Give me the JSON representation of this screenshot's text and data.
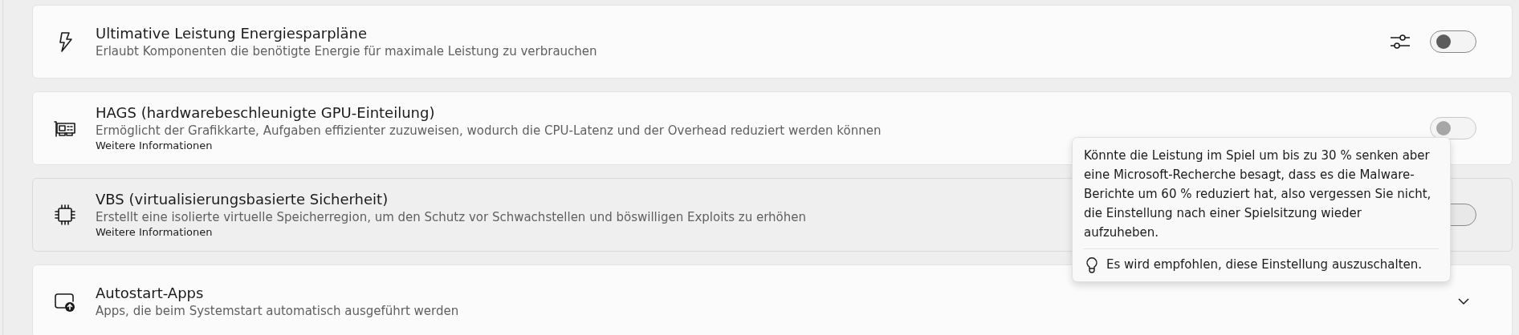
{
  "settings": [
    {
      "title": "Ultimative Leistung Energiesparpläne",
      "description": "Erlaubt Komponenten die benötigte Energie für maximale Leistung zu verbrauchen",
      "kind": "toggle",
      "on": false,
      "disabled": false,
      "hovered": false,
      "has_options": true
    },
    {
      "title": "HAGS (hardwarebeschleunigte GPU-Einteilung)",
      "description": "Ermöglicht der Grafikkarte, Aufgaben effizienter zuzuweisen, wodurch die CPU-Latenz und der Overhead reduziert werden können",
      "link": "Weitere Informationen",
      "kind": "toggle",
      "on": false,
      "disabled": true,
      "hovered": false,
      "has_options": false
    },
    {
      "title": "VBS (virtualisierungsbasierte Sicherheit)",
      "description": "Erstellt eine isolierte virtuelle Speicherregion, um den Schutz vor Schwachstellen und böswilligen Exploits zu erhöhen",
      "link": "Weitere Informationen",
      "kind": "toggle",
      "on": false,
      "disabled": false,
      "hovered": true,
      "has_options": false
    },
    {
      "title": "Autostart-Apps",
      "description": "Apps, die beim Systemstart automatisch ausgeführt werden",
      "kind": "expander",
      "expanded": false,
      "hovered": false,
      "has_options": false
    }
  ],
  "tooltip": {
    "text": "Könnte die Leistung im Spiel um bis zu 30 % senken aber eine Microsoft-Recherche besagt, dass es die Malware-Berichte um 60 % reduziert hat, also vergessen Sie nicht, die Einstellung nach einer Spielsitzung wieder aufzuheben.",
    "tip": "Es wird empfohlen, diese Einstellung auszuschalten."
  }
}
